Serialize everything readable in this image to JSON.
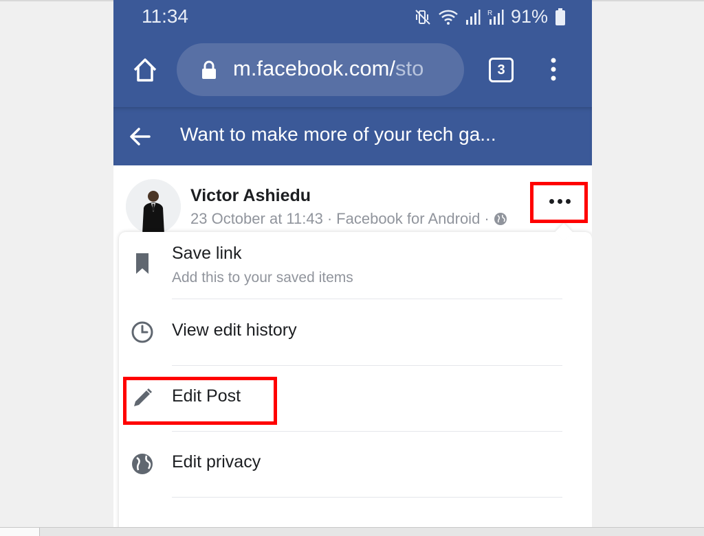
{
  "status_bar": {
    "time": "11:34",
    "battery": "91%",
    "icons": [
      "mute-vibrate-icon",
      "wifi-icon",
      "signal-icon",
      "roaming-signal-icon",
      "battery-icon"
    ]
  },
  "browser": {
    "url_main": "m.facebook.com/",
    "url_faded": "sto",
    "tab_count": "3",
    "icons": [
      "home-icon",
      "lock-icon",
      "kebab-menu-icon"
    ]
  },
  "page_header": {
    "title": "Want to make more of your tech ga..."
  },
  "post": {
    "author": "Victor Ashiedu",
    "date": "23 October at 11:43",
    "separator": "·",
    "source": "Facebook for Android",
    "visibility_icon": "globe-icon"
  },
  "menu": {
    "items": [
      {
        "label": "Save link",
        "sub": "Add this to your saved items",
        "icon": "bookmark-icon"
      },
      {
        "label": "View edit history",
        "sub": "",
        "icon": "clock-icon"
      },
      {
        "label": "Edit Post",
        "sub": "",
        "icon": "pencil-icon"
      },
      {
        "label": "Edit privacy",
        "sub": "",
        "icon": "globe-icon"
      }
    ]
  },
  "colors": {
    "facebook_blue": "#3b5998",
    "highlight_red": "#ff0000"
  }
}
